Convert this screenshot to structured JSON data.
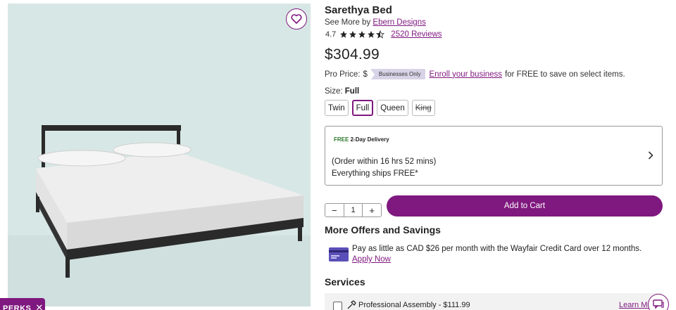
{
  "product": {
    "title": "Sarethya Bed",
    "see_more_prefix": "See More by",
    "brand": "Ebern Designs",
    "rating": "4.7",
    "rating_value": 4.7,
    "stars_max": 5,
    "reviews": "2520 Reviews",
    "price": "$304.99"
  },
  "pro_price": {
    "label": "Pro Price:",
    "hidden_value": "$",
    "badge": "Businesses Only",
    "enroll_link": "Enroll your business",
    "rest": "for FREE to save on select items."
  },
  "size": {
    "label": "Size:",
    "selected": "Full",
    "options": [
      "Twin",
      "Full",
      "Queen",
      "King"
    ]
  },
  "delivery": {
    "badge_free": "FREE",
    "badge_rest": "2-Day Delivery",
    "order_within": "(Order within 16 hrs 52 mins)",
    "ships": "Everything ships FREE*"
  },
  "cart": {
    "quantity": "1",
    "minus": "−",
    "plus": "+",
    "add_label": "Add to Cart"
  },
  "offers": {
    "title": "More Offers and Savings",
    "credit_text": "Pay as little as CAD $26 per month with the Wayfair Credit Card over 12 months.",
    "apply_link": "Apply Now"
  },
  "services": {
    "title": "Services",
    "assembly": "Professional Assembly - $111.99",
    "learn_more": "Learn More"
  },
  "perks": {
    "label": "PERKS",
    "close": "✕"
  },
  "icons": {
    "favorite": "heart-icon",
    "chat": "chat-icon",
    "chevron": "chevron-right-icon",
    "card": "credit-card-icon",
    "tool": "tool-icon"
  },
  "colors": {
    "brand": "#7f187f",
    "star": "#222222"
  }
}
